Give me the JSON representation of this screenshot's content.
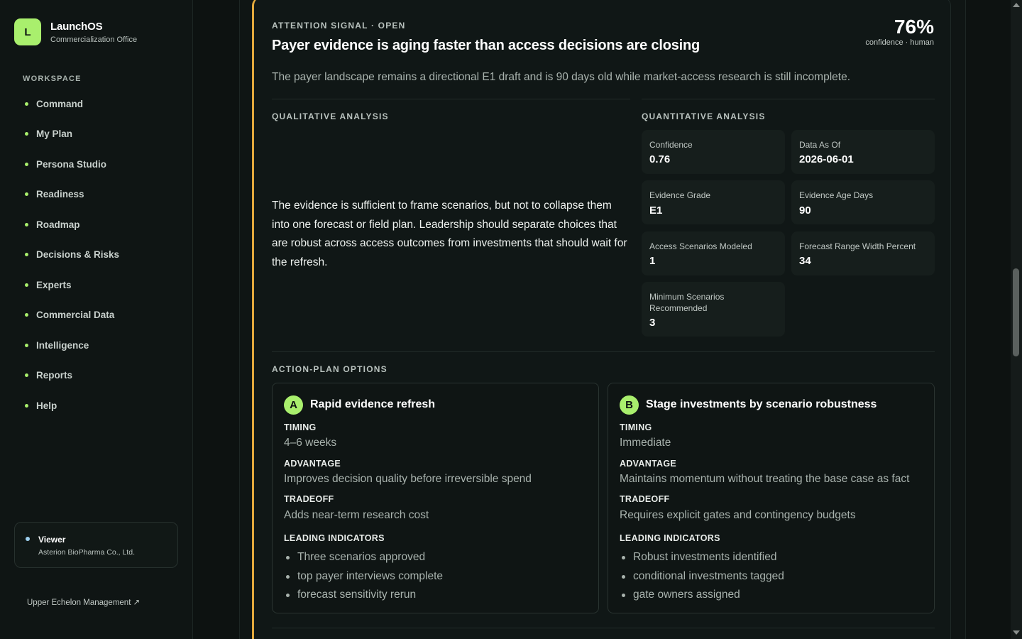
{
  "brand": {
    "logo_letter": "L",
    "name": "LaunchOS",
    "subtitle": "Commercialization Office"
  },
  "sidebar": {
    "section_label": "WORKSPACE",
    "items": [
      {
        "label": "Command"
      },
      {
        "label": "My Plan"
      },
      {
        "label": "Persona Studio"
      },
      {
        "label": "Readiness"
      },
      {
        "label": "Roadmap"
      },
      {
        "label": "Decisions & Risks"
      },
      {
        "label": "Experts"
      },
      {
        "label": "Commercial Data"
      },
      {
        "label": "Intelligence"
      },
      {
        "label": "Reports"
      },
      {
        "label": "Help"
      }
    ],
    "viewer": {
      "role": "Viewer",
      "org": "Asterion BioPharma Co., Ltd."
    },
    "footer_link": "Upper Echelon Management ↗"
  },
  "signal": {
    "kicker": "ATTENTION SIGNAL · OPEN",
    "title": "Payer evidence is aging faster than access decisions are closing",
    "confidence_pct": "76%",
    "confidence_note": "confidence · human",
    "summary": "The payer landscape remains a directional E1 draft and is 90 days old while market-access research is still incomplete.",
    "qualitative_label": "QUALITATIVE ANALYSIS",
    "qualitative_text": "The evidence is sufficient to frame scenarios, but not to collapse them into one forecast or field plan. Leadership should separate choices that are robust across access outcomes from investments that should wait for the refresh.",
    "quantitative_label": "QUANTITATIVE ANALYSIS",
    "metrics": [
      {
        "label": "Confidence",
        "value": "0.76"
      },
      {
        "label": "Data As Of",
        "value": "2026-06-01"
      },
      {
        "label": "Evidence Grade",
        "value": "E1"
      },
      {
        "label": "Evidence Age Days",
        "value": "90"
      },
      {
        "label": "Access Scenarios Modeled",
        "value": "1"
      },
      {
        "label": "Forecast Range Width Percent",
        "value": "34"
      },
      {
        "label": "Minimum Scenarios Recommended",
        "value": "3"
      }
    ],
    "options_label": "ACTION-PLAN OPTIONS",
    "options": [
      {
        "badge": "A",
        "title": "Rapid evidence refresh",
        "timing_label": "TIMING",
        "timing": "4–6 weeks",
        "advantage_label": "ADVANTAGE",
        "advantage": "Improves decision quality before irreversible spend",
        "tradeoff_label": "TRADEOFF",
        "tradeoff": "Adds near-term research cost",
        "indicators_label": "LEADING INDICATORS",
        "indicators": [
          "Three scenarios approved",
          "top payer interviews complete",
          "forecast sensitivity rerun"
        ]
      },
      {
        "badge": "B",
        "title": "Stage investments by scenario robustness",
        "timing_label": "TIMING",
        "timing": "Immediate",
        "advantage_label": "ADVANTAGE",
        "advantage": "Maintains momentum without treating the base case as fact",
        "tradeoff_label": "TRADEOFF",
        "tradeoff": "Requires explicit gates and contingency budgets",
        "indicators_label": "LEADING INDICATORS",
        "indicators": [
          "Robust investments identified",
          "conditional investments tagged",
          "gate owners assigned"
        ]
      }
    ]
  },
  "colors": {
    "accent": "#a9ef6d",
    "signal_border": "#e2a83c",
    "background": "#0d1211"
  }
}
